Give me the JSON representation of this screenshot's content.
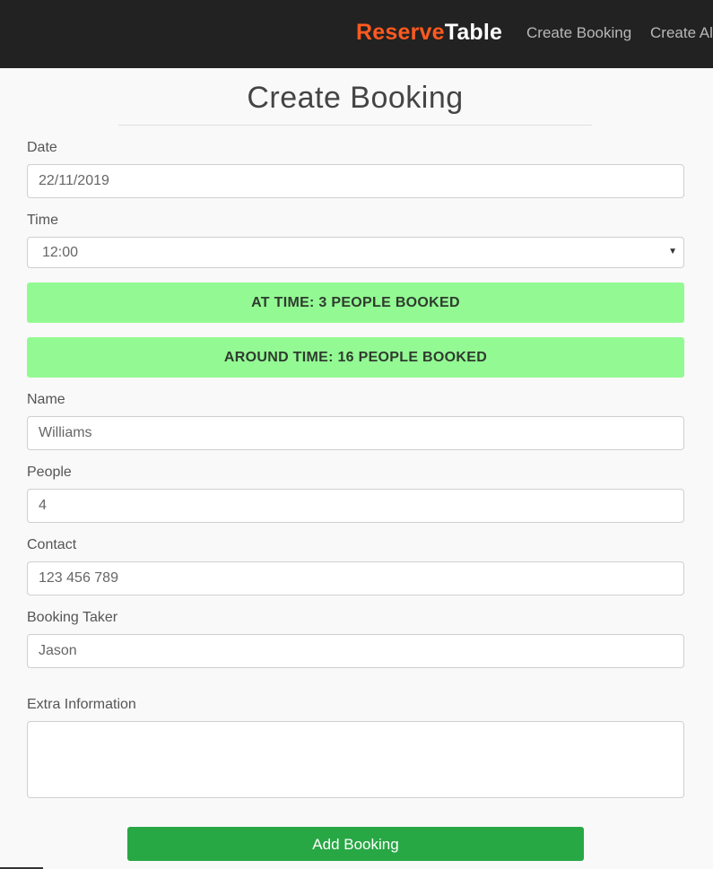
{
  "nav": {
    "brand_part1": "Reserve",
    "brand_part2": "Table",
    "links": [
      "Create Booking",
      "Create Al"
    ]
  },
  "page": {
    "title": "Create Booking"
  },
  "form": {
    "date": {
      "label": "Date",
      "value": "22/11/2019"
    },
    "time": {
      "label": "Time",
      "value": "12:00"
    },
    "alerts": {
      "at_time": "AT TIME: 3 PEOPLE BOOKED",
      "around_time": "AROUND TIME: 16 PEOPLE BOOKED"
    },
    "name": {
      "label": "Name",
      "value": "Williams"
    },
    "people": {
      "label": "People",
      "value": "4"
    },
    "contact": {
      "label": "Contact",
      "value": "123 456 789"
    },
    "booking_taker": {
      "label": "Booking Taker",
      "value": "Jason"
    },
    "extra_info": {
      "label": "Extra Information",
      "value": ""
    },
    "submit_label": "Add Booking"
  },
  "colors": {
    "navbar_bg": "#222222",
    "brand_accent": "#ff5a1f",
    "alert_bg": "#93fa93",
    "submit_bg": "#28a745"
  }
}
